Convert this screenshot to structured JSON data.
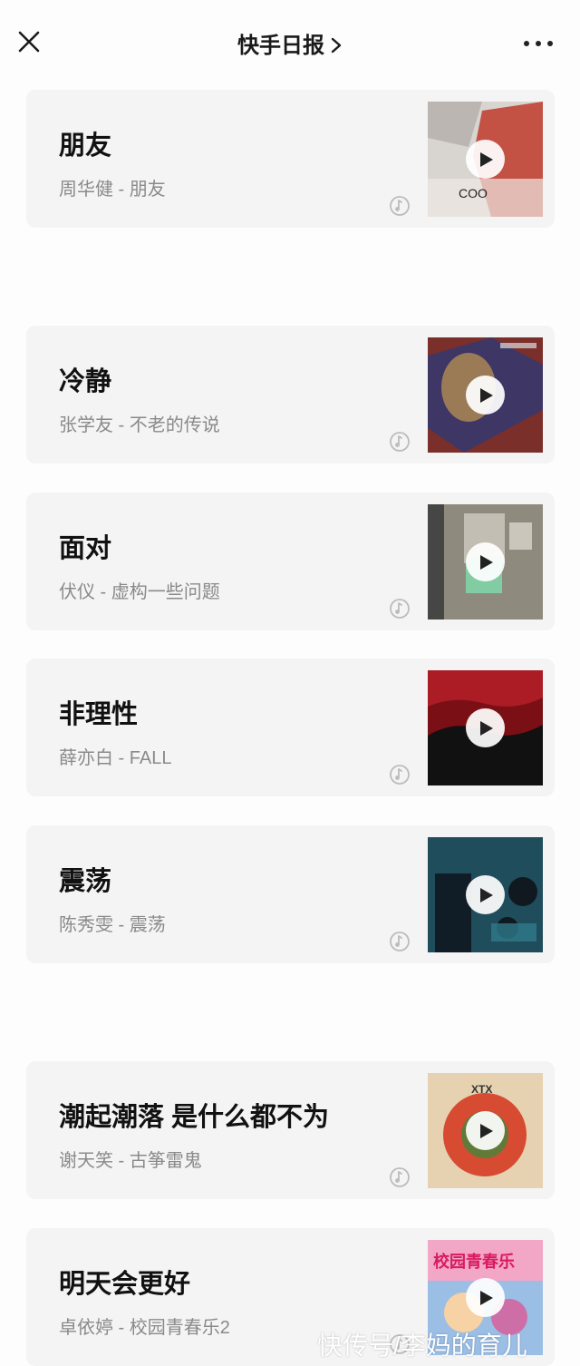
{
  "header": {
    "title": "快手日报"
  },
  "songs": [
    {
      "title": "朋友",
      "artist_line": "周华健 - 朋友",
      "cover_colors": [
        "#d8d4d0",
        "#c0392b",
        "#efeae4"
      ],
      "cover_text": "COO"
    },
    {
      "title": "冷静",
      "artist_line": "张学友 - 不老的传说",
      "cover_colors": [
        "#7a2f2a",
        "#2b3a7a",
        "#e8b24b"
      ]
    },
    {
      "title": "面对",
      "artist_line": "伏仪 - 虚构一些问题",
      "cover_colors": [
        "#8f8a7e",
        "#3a3a3a",
        "#7fd3a6"
      ]
    },
    {
      "title": "非理性",
      "artist_line": "薛亦白 - FALL",
      "cover_colors": [
        "#7a1016",
        "#c0222c",
        "#111111"
      ]
    },
    {
      "title": "震荡",
      "artist_line": "陈秀雯 - 震荡",
      "cover_colors": [
        "#1f4d5c",
        "#2e7b8c",
        "#101820"
      ]
    },
    {
      "title": "潮起潮落 是什么都不为",
      "artist_line": "谢天笑 - 古筝雷鬼",
      "cover_colors": [
        "#e6d2b0",
        "#d2341c",
        "#2f8f3a"
      ],
      "cover_text": "XTX"
    },
    {
      "title": "明天会更好",
      "artist_line": "卓依婷 - 校园青春乐2",
      "cover_colors": [
        "#f2a7c7",
        "#7ec6ef",
        "#e34c8c"
      ],
      "cover_text": "校园青春乐"
    }
  ],
  "watermark": "快传号/李妈的育儿"
}
